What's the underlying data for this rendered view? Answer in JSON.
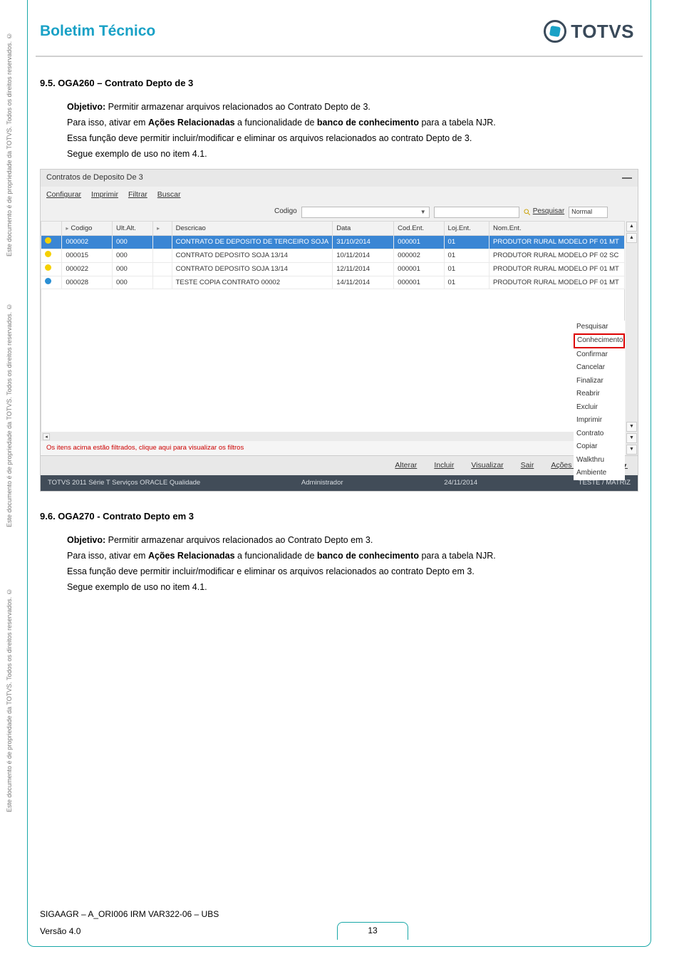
{
  "side_text": "Este documento é de propriedade da TOTVS. Todos os direitos reservados. ©",
  "header": {
    "title": "Boletim Técnico",
    "logo_text": "TOTVS"
  },
  "section1": {
    "heading": "9.5.  OGA260 – Contrato Depto de 3",
    "objetivo_label": "Objetivo:",
    "objetivo_text": " Permitir armazenar arquivos relacionados ao Contrato Depto de 3.",
    "p2a": "Para isso, ativar em ",
    "p2b": "Ações Relacionadas",
    "p2c": " a funcionalidade de ",
    "p2d": "banco de conhecimento",
    "p2e": " para a tabela NJR.",
    "p3": "Essa função deve permitir incluir/modificar e eliminar os arquivos relacionados ao contrato Depto de 3.",
    "p4": "Segue exemplo de uso no item 4.1."
  },
  "screenshot": {
    "title": "Contratos de Deposito De 3",
    "menubar": [
      "Configurar",
      "Imprimir",
      "Filtrar",
      "Buscar"
    ],
    "search_label": "Codigo",
    "search_btn": "Pesquisar",
    "normal_label": "Normal",
    "columns": [
      "",
      "Codigo",
      "Ult.Alt.",
      "",
      "Descricao",
      "Data",
      "Cod.Ent.",
      "Loj.Ent.",
      "Nom.Ent."
    ],
    "rows": [
      {
        "dot": "yellow",
        "codigo": "000002",
        "alt": "000",
        "desc": "CONTRATO DE DEPOSITO DE TERCEIRO SOJA",
        "data": "31/10/2014",
        "codent": "000001",
        "lojent": "01",
        "noment": "PRODUTOR RURAL MODELO PF 01 MT",
        "sel": true
      },
      {
        "dot": "yellow",
        "codigo": "000015",
        "alt": "000",
        "desc": "CONTRATO DEPOSITO SOJA 13/14",
        "data": "10/11/2014",
        "codent": "000002",
        "lojent": "01",
        "noment": "PRODUTOR RURAL MODELO PF 02 SC",
        "sel": false
      },
      {
        "dot": "yellow",
        "codigo": "000022",
        "alt": "000",
        "desc": "CONTRATO DEPOSITO SOJA 13/14",
        "data": "12/11/2014",
        "codent": "000001",
        "lojent": "01",
        "noment": "PRODUTOR RURAL MODELO PF 01 MT",
        "sel": false
      },
      {
        "dot": "blue",
        "codigo": "000028",
        "alt": "000",
        "desc": "TESTE COPIA CONTRATO 00002",
        "data": "14/11/2014",
        "codent": "000001",
        "lojent": "01",
        "noment": "PRODUTOR RURAL MODELO PF 01 MT",
        "sel": false
      }
    ],
    "context_menu": [
      "Pesquisar",
      "Conhecimento",
      "Confirmar",
      "Cancelar",
      "Finalizar",
      "Reabrir",
      "Excluir",
      "Imprimir",
      "Contrato",
      "Copiar",
      "Walkthru",
      "Ambiente"
    ],
    "context_highlight_index": 1,
    "filter_note": "Os itens acima estão filtrados, clique aqui para visualizar os filtros",
    "bottombar": [
      "Alterar",
      "Incluir",
      "Visualizar",
      "Sair",
      "Ações Relacionadas"
    ],
    "statusbar": {
      "left": "TOTVS 2011 Série T Serviços ORACLE Qualidade",
      "mid1": "Administrador",
      "mid2": "24/11/2014",
      "right": "TESTE / MATRIZ"
    }
  },
  "section2": {
    "heading": "9.6.  OGA270 - Contrato Depto em 3",
    "objetivo_label": "Objetivo:",
    "objetivo_text": " Permitir armazenar arquivos relacionados ao Contrato Depto em 3.",
    "p2a": "Para isso, ativar em ",
    "p2b": "Ações Relacionadas",
    "p2c": " a funcionalidade de ",
    "p2d": "banco de conhecimento",
    "p2e": " para a tabela NJR.",
    "p3": "Essa função deve permitir incluir/modificar e eliminar os arquivos relacionados ao contrato Depto em 3.",
    "p4": "Segue exemplo de uso no item 4.1."
  },
  "footer": {
    "line1": "SIGAAGR – A_ORI006 IRM VAR322-06 – UBS",
    "version": "Versão 4.0",
    "page": "13"
  }
}
